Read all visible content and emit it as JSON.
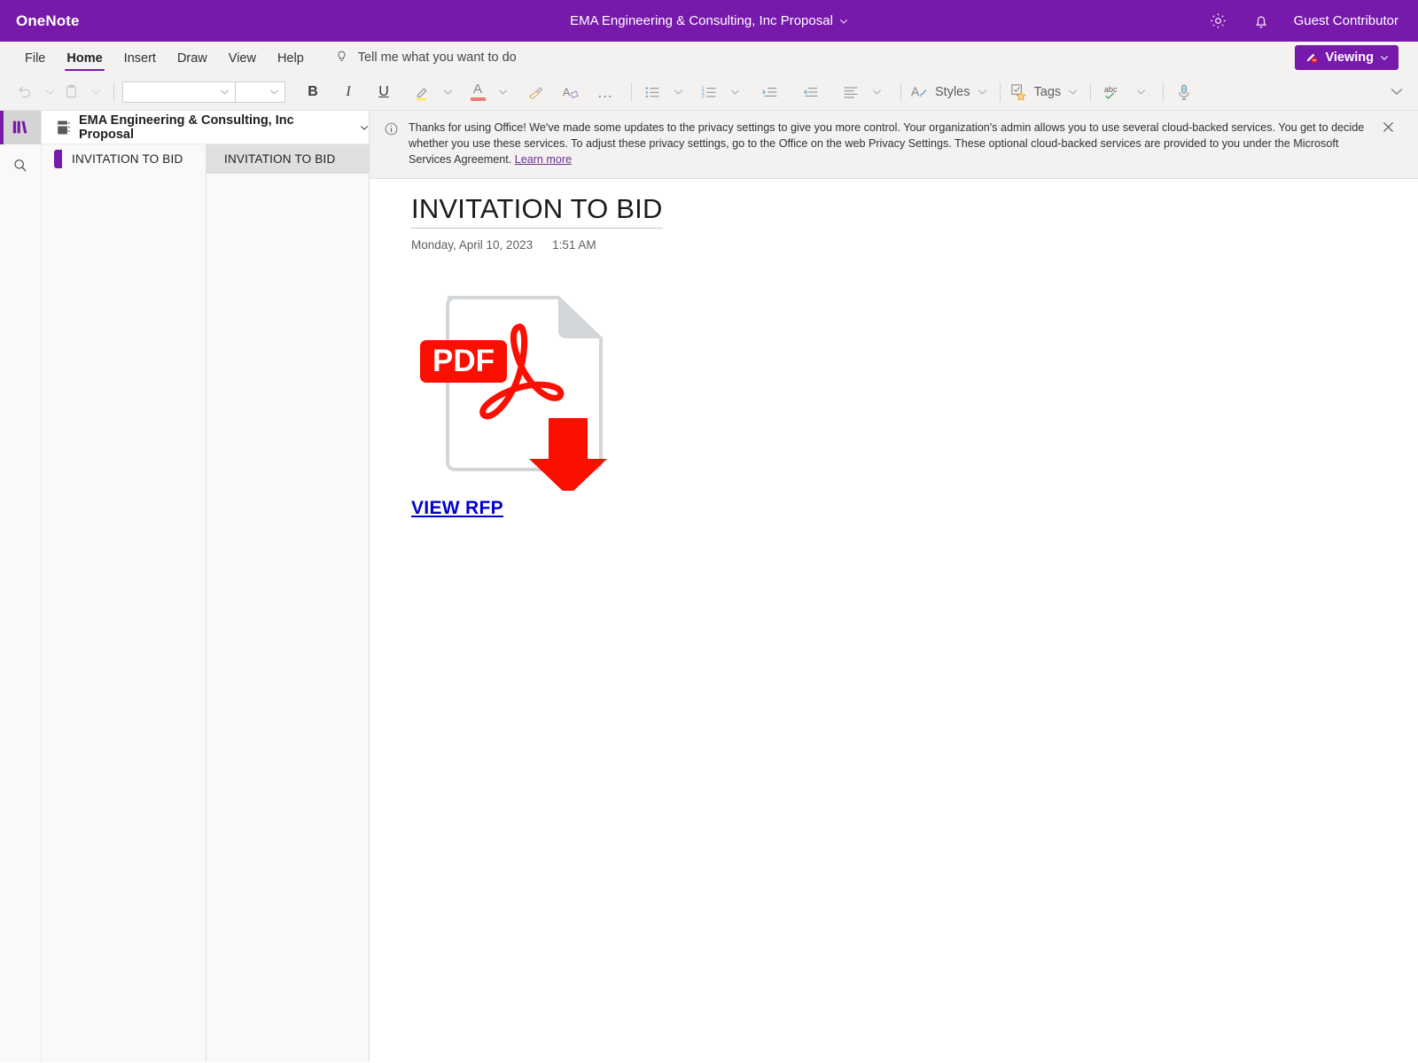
{
  "titlebar": {
    "app_name": "OneNote",
    "doc_title": "EMA Engineering & Consulting, Inc Proposal",
    "settings_icon": "gear-icon",
    "notifications_icon": "bell-icon",
    "user": "Guest Contributor",
    "accent_color": "#7719aa"
  },
  "ribbon": {
    "tabs": [
      {
        "label": "File",
        "active": false
      },
      {
        "label": "Home",
        "active": true
      },
      {
        "label": "Insert",
        "active": false
      },
      {
        "label": "Draw",
        "active": false
      },
      {
        "label": "View",
        "active": false
      },
      {
        "label": "Help",
        "active": false
      }
    ],
    "tell_me": "Tell me what you want to do",
    "tell_me_icon": "lightbulb-icon",
    "mode_button": {
      "label": "Viewing",
      "icon": "pen-disabled-icon",
      "color": "#7719aa"
    },
    "collapse_icon": "chevron-down-icon"
  },
  "toolbar": {
    "undo": "undo-icon",
    "paste": "paste-icon",
    "font_name": "",
    "font_size": "",
    "bold": "B",
    "italic": "I",
    "underline": "U",
    "highlight": "highlighter-icon",
    "highlight_color": "#ffec3d",
    "font_color": "A",
    "font_color_swatch": "#ef7b7b",
    "format_painter": "format-painter-icon",
    "clear_formatting": "clear-formatting-icon",
    "more": "…",
    "bullets": "bulleted-list-icon",
    "numbering": "numbered-list-icon",
    "decrease_indent": "decrease-indent-icon",
    "increase_indent": "increase-indent-icon",
    "align": "align-icon",
    "styles": "Styles",
    "styles_icon": "styles-icon",
    "tags": "Tags",
    "tags_icon": "tag-star-icon",
    "spelling": "abc",
    "spelling_icon": "spellcheck-icon",
    "dictate": "microphone-icon"
  },
  "rail": {
    "notebook_icon": "notebook-list-icon",
    "search_icon": "search-icon"
  },
  "nav": {
    "notebook_name": "EMA Engineering & Consulting, Inc Proposal",
    "notebook_icon": "notebook-icon",
    "sections": [
      {
        "name": "INVITATION TO BID",
        "selected": true
      }
    ],
    "pages": [
      {
        "name": "INVITATION TO BID",
        "selected": true
      }
    ]
  },
  "banner": {
    "icon": "info-icon",
    "text": "Thanks for using Office! We've made some updates to the privacy settings to give you more control. Your organization's admin allows you to use several cloud-backed services. You get to decide whether you use these services. To adjust these privacy settings, go to the Office on the web Privacy Settings. These optional cloud-backed services are provided to you under the Microsoft Services Agreement. ",
    "link": "Learn more",
    "close_icon": "close-icon"
  },
  "page": {
    "title": "INVITATION TO BID",
    "date": "Monday, April 10, 2023",
    "time": "1:51 AM",
    "attachment": {
      "icon": "pdf-download-icon",
      "badge": "PDF",
      "badge_color": "#fa0f00",
      "link_label": "VIEW RFP",
      "link_color": "#0000cd"
    }
  }
}
